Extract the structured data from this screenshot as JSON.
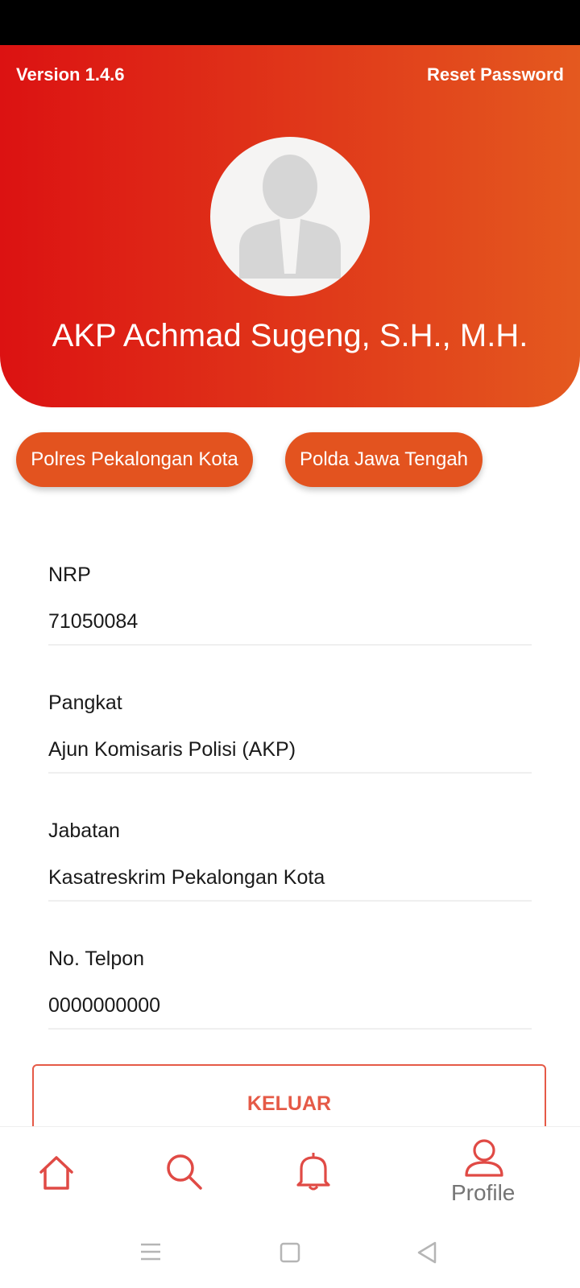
{
  "header": {
    "version": "Version 1.4.6",
    "reset_password": "Reset Password",
    "name": "AKP Achmad Sugeng, S.H., M.H."
  },
  "chips": [
    {
      "label": "Polres Pekalongan Kota"
    },
    {
      "label": "Polda Jawa Tengah"
    }
  ],
  "fields": [
    {
      "label": "NRP",
      "value": "71050084"
    },
    {
      "label": "Pangkat",
      "value": "Ajun Komisaris Polisi (AKP)"
    },
    {
      "label": "Jabatan",
      "value": "Kasatreskrim Pekalongan Kota"
    },
    {
      "label": "No. Telpon",
      "value": "0000000000"
    }
  ],
  "logout_label": "KELUAR",
  "nav": {
    "items": [
      {
        "icon": "home-icon"
      },
      {
        "icon": "search-icon"
      },
      {
        "icon": "bell-icon"
      },
      {
        "icon": "profile-icon",
        "label": "Profile"
      }
    ]
  },
  "colors": {
    "accent": "#e3531f",
    "header_start": "#dc1212",
    "header_end": "#e4591f",
    "logout": "#e55a47",
    "nav_icon": "#e04a45"
  }
}
